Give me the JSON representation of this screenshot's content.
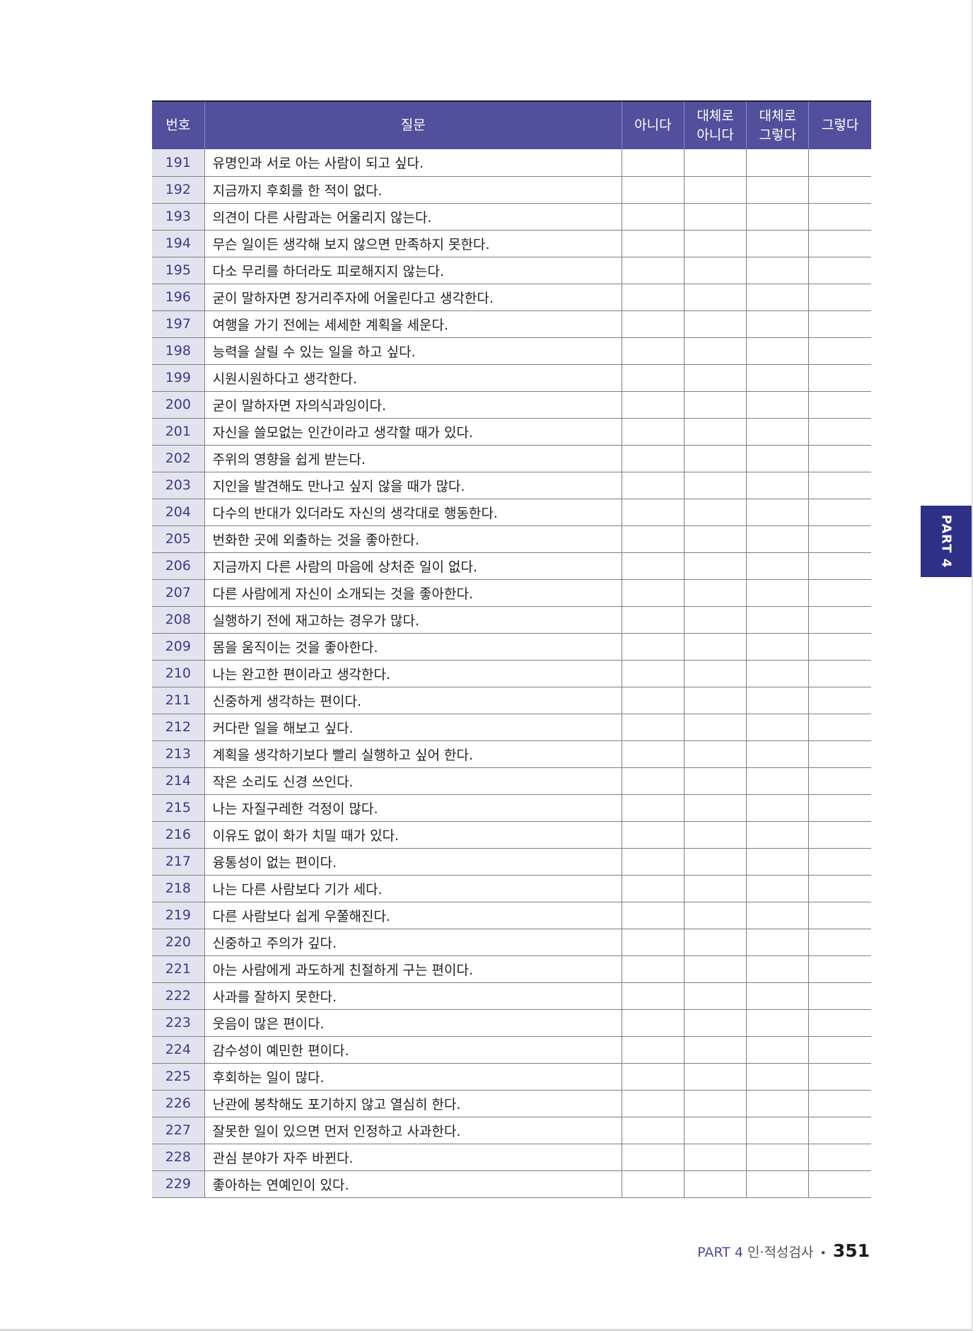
{
  "table": {
    "headers": {
      "number": "번호",
      "question": "질문",
      "opt1": "아니다",
      "opt2_line1": "대체로",
      "opt2_line2": "아니다",
      "opt3_line1": "대체로",
      "opt3_line2": "그렇다",
      "opt4": "그렇다"
    },
    "rows": [
      {
        "no": "191",
        "q": "유명인과 서로 아는 사람이 되고 싶다."
      },
      {
        "no": "192",
        "q": "지금까지 후회를 한 적이 없다."
      },
      {
        "no": "193",
        "q": "의견이 다른 사람과는 어울리지 않는다."
      },
      {
        "no": "194",
        "q": "무슨 일이든 생각해 보지 않으면 만족하지 못한다."
      },
      {
        "no": "195",
        "q": "다소 무리를 하더라도 피로해지지 않는다."
      },
      {
        "no": "196",
        "q": "굳이 말하자면 장거리주자에 어울린다고 생각한다."
      },
      {
        "no": "197",
        "q": "여행을 가기 전에는 세세한 계획을 세운다."
      },
      {
        "no": "198",
        "q": "능력을 살릴 수 있는 일을 하고 싶다."
      },
      {
        "no": "199",
        "q": "시원시원하다고 생각한다."
      },
      {
        "no": "200",
        "q": "굳이 말하자면 자의식과잉이다."
      },
      {
        "no": "201",
        "q": "자신을 쓸모없는 인간이라고 생각할 때가 있다."
      },
      {
        "no": "202",
        "q": "주위의 영향을 쉽게 받는다."
      },
      {
        "no": "203",
        "q": "지인을 발견해도 만나고 싶지 않을 때가 많다."
      },
      {
        "no": "204",
        "q": "다수의 반대가 있더라도 자신의 생각대로 행동한다."
      },
      {
        "no": "205",
        "q": "번화한 곳에 외출하는 것을 좋아한다."
      },
      {
        "no": "206",
        "q": "지금까지 다른 사람의 마음에 상처준 일이 없다."
      },
      {
        "no": "207",
        "q": "다른 사람에게 자신이 소개되는 것을 좋아한다."
      },
      {
        "no": "208",
        "q": "실행하기 전에 재고하는 경우가 많다."
      },
      {
        "no": "209",
        "q": "몸을 움직이는 것을 좋아한다."
      },
      {
        "no": "210",
        "q": "나는 완고한 편이라고 생각한다."
      },
      {
        "no": "211",
        "q": "신중하게 생각하는 편이다."
      },
      {
        "no": "212",
        "q": "커다란 일을 해보고 싶다."
      },
      {
        "no": "213",
        "q": "계획을 생각하기보다 빨리 실행하고 싶어 한다."
      },
      {
        "no": "214",
        "q": "작은 소리도 신경 쓰인다."
      },
      {
        "no": "215",
        "q": "나는 자질구레한 걱정이 많다."
      },
      {
        "no": "216",
        "q": "이유도 없이 화가 치밀 때가 있다."
      },
      {
        "no": "217",
        "q": "융통성이 없는 편이다."
      },
      {
        "no": "218",
        "q": "나는 다른 사람보다 기가 세다."
      },
      {
        "no": "219",
        "q": "다른 사람보다 쉽게 우쭐해진다."
      },
      {
        "no": "220",
        "q": "신중하고 주의가 깊다."
      },
      {
        "no": "221",
        "q": "아는 사람에게 과도하게 친절하게 구는 편이다."
      },
      {
        "no": "222",
        "q": "사과를 잘하지 못한다."
      },
      {
        "no": "223",
        "q": "웃음이 많은 편이다."
      },
      {
        "no": "224",
        "q": "감수성이 예민한 편이다."
      },
      {
        "no": "225",
        "q": "후회하는 일이 많다."
      },
      {
        "no": "226",
        "q": "난관에 봉착해도 포기하지 않고 열심히 한다."
      },
      {
        "no": "227",
        "q": "잘못한 일이 있으면 먼저 인정하고 사과한다."
      },
      {
        "no": "228",
        "q": "관심 분야가 자주 바뀐다."
      },
      {
        "no": "229",
        "q": "좋아하는 연예인이 있다."
      }
    ]
  },
  "side_tab": {
    "label": "PART 4"
  },
  "footer": {
    "part": "PART 4",
    "title": "인·적성검사",
    "separator": "•",
    "page_number": "351"
  },
  "colors": {
    "header_bg": "#524f9c",
    "number_cell_bg": "#e3e3ef",
    "number_text": "#3b3a8e",
    "side_tab_bg": "#2e2f86"
  }
}
